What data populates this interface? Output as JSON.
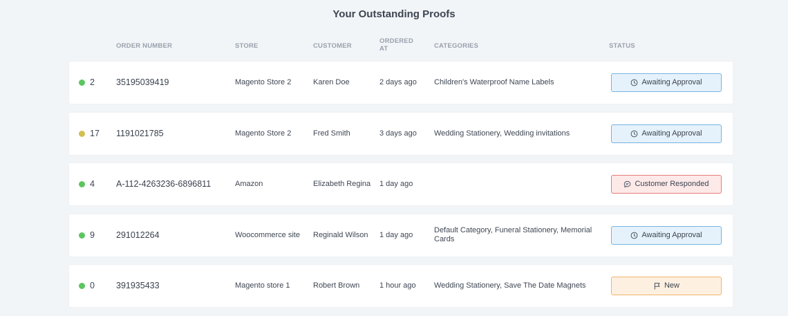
{
  "title": "Your Outstanding Proofs",
  "headers": {
    "order_number": "ORDER NUMBER",
    "store": "STORE",
    "customer": "CUSTOMER",
    "ordered_at_line1": "ORDERED",
    "ordered_at_line2": "AT",
    "categories": "CATEGORIES",
    "status": "STATUS"
  },
  "colors": {
    "dot_green": "#5cc55f",
    "dot_yellow": "#d3bf53"
  },
  "rows": [
    {
      "count": "2",
      "dot_color": "#5cc55f",
      "order_number": "35195039419",
      "store": "Magento Store 2",
      "customer": "Karen Doe",
      "ordered_at": "2 days ago",
      "categories": "Children's Waterproof Name Labels",
      "status": "Awaiting Approval",
      "status_type": "awaiting",
      "status_icon": "clock-icon"
    },
    {
      "count": "17",
      "dot_color": "#d3bf53",
      "order_number": "1191021785",
      "store": "Magento Store 2",
      "customer": "Fred Smith",
      "ordered_at": "3 days ago",
      "categories": "Wedding Stationery, Wedding invitations",
      "status": "Awaiting Approval",
      "status_type": "awaiting",
      "status_icon": "clock-icon"
    },
    {
      "count": "4",
      "dot_color": "#5cc55f",
      "order_number": "A-112-4263236-6896811",
      "store": "Amazon",
      "customer": "Elizabeth Regina",
      "ordered_at": "1 day ago",
      "categories": "",
      "status": "Customer Responded",
      "status_type": "responded",
      "status_icon": "chat-bubble-icon"
    },
    {
      "count": "9",
      "dot_color": "#5cc55f",
      "order_number": "291012264",
      "store": "Woocommerce site",
      "customer": "Reginald Wilson",
      "ordered_at": "1 day ago",
      "categories": "Default Category, Funeral Stationery, Memorial Cards",
      "status": "Awaiting Approval",
      "status_type": "awaiting",
      "status_icon": "clock-icon"
    },
    {
      "count": "0",
      "dot_color": "#5cc55f",
      "order_number": "391935433",
      "store": "Magento store 1",
      "customer": "Robert Brown",
      "ordered_at": "1 hour ago",
      "categories": "Wedding Stationery, Save The Date Magnets",
      "status": "New",
      "status_type": "new",
      "status_icon": "flag-icon"
    }
  ]
}
